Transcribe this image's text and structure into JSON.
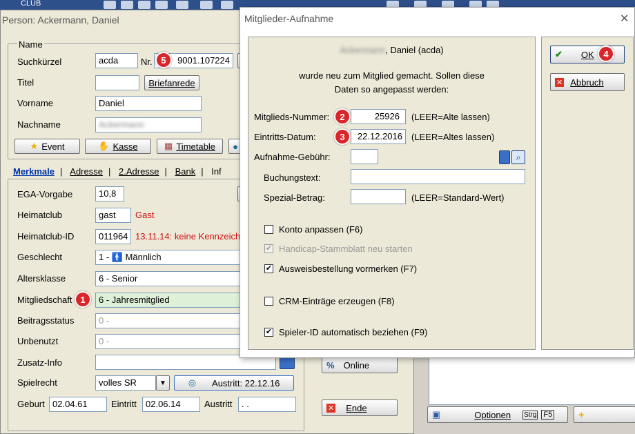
{
  "taskbar": {
    "label": "CLUB"
  },
  "person": {
    "title": "Person: Ackermann, Daniel",
    "name_group": "Name",
    "suchkuerzel_label": "Suchkürzel",
    "suchkuerzel_value": "acda",
    "nr_label": "Nr.",
    "nr_value": "9001.107224",
    "titel_label": "Titel",
    "briefanrede_btn": "Briefanrede",
    "vorname_label": "Vorname",
    "vorname_value": "Daniel",
    "nachname_label": "Nachname",
    "nachname_value": "Ackermann",
    "buttons": {
      "event": "Event",
      "kasse": "Kasse",
      "timetable": "Timetable"
    },
    "tabs": [
      "Merkmale",
      "Adresse",
      "2.Adresse",
      "Bank",
      "Inf"
    ],
    "rows": {
      "ega_label": "EGA-Vorgabe",
      "ega_value": "10,8",
      "heimatclub_label": "Heimatclub",
      "heimatclub_value": "gast",
      "heimatclub_note": "Gast",
      "heimatclubid_label": "Heimatclub-ID",
      "heimatclubid_value": "011964",
      "heimatclubid_note": "13.11.14: keine Kennzeich",
      "geschlecht_label": "Geschlecht",
      "geschlecht_value": "1 - 🚹 Männlich",
      "altersklasse_label": "Altersklasse",
      "altersklasse_value": "6 - Senior",
      "mitgliedschaft_label": "Mitgliedschaft",
      "mitgliedschaft_value": "6 - Jahresmitglied",
      "beitragsstatus_label": "Beitragsstatus",
      "beitragsstatus_value": "0 -",
      "unbenutzt_label": "Unbenutzt",
      "unbenutzt_value": "0 -",
      "zusatz_label": "Zusatz-Info",
      "spielrecht_label": "Spielrecht",
      "spielrecht_value": "volles SR",
      "austritt_btn": "Austritt: 22.12.16",
      "geburt_label": "Geburt",
      "geburt_value": "02.04.61",
      "eintritt_label": "Eintritt",
      "eintritt_value": "02.06.14",
      "austritt_label": "Austritt",
      "austritt_value": ". ."
    }
  },
  "middle": {
    "online_btn": "Online",
    "ende_btn": "Ende"
  },
  "right": {
    "optionen_btn": "Optionen",
    "strg_badge": "Strg",
    "f5_badge": "F5"
  },
  "dialog": {
    "title": "Mitglieder-Aufnahme",
    "close": "✕",
    "header_name": "Ackermann",
    "header_rest": ", Daniel (acda)",
    "message_line1": "wurde neu zum Mitglied gemacht. Sollen diese",
    "message_line2": "Daten so angepasst werden:",
    "nummer_label": "Mitglieds-Nummer:",
    "nummer_value": "25926",
    "nummer_hint": "(LEER=Alte lassen)",
    "datum_label": "Eintritts-Datum:",
    "datum_value": "22.12.2016",
    "datum_hint": "(LEER=Altes lassen)",
    "gebuehr_label": "Aufnahme-Gebühr:",
    "buchung_label": "Buchungstext:",
    "spezial_label": "Spezial-Betrag:",
    "spezial_hint": "(LEER=Standard-Wert)",
    "checkboxes": [
      {
        "label": "Konto anpassen (F6)",
        "checked": false,
        "disabled": false
      },
      {
        "label": "Handicap-Stammblatt neu starten",
        "checked": true,
        "disabled": true
      },
      {
        "label": "Ausweisbestellung vormerken (F7)",
        "checked": true,
        "disabled": false
      },
      {
        "label": "CRM-Einträge erzeugen (F8)",
        "checked": false,
        "disabled": false
      },
      {
        "label": "Spieler-ID automatisch beziehen (F9)",
        "checked": true,
        "disabled": false
      }
    ],
    "ok_btn": "OK",
    "abbruch_btn": "Abbruch"
  },
  "badges": [
    "1",
    "2",
    "3",
    "4",
    "5"
  ],
  "colors": {
    "badge": "#d9262b",
    "highlight_field": "#dff0d8",
    "note_red": "#d01010"
  }
}
